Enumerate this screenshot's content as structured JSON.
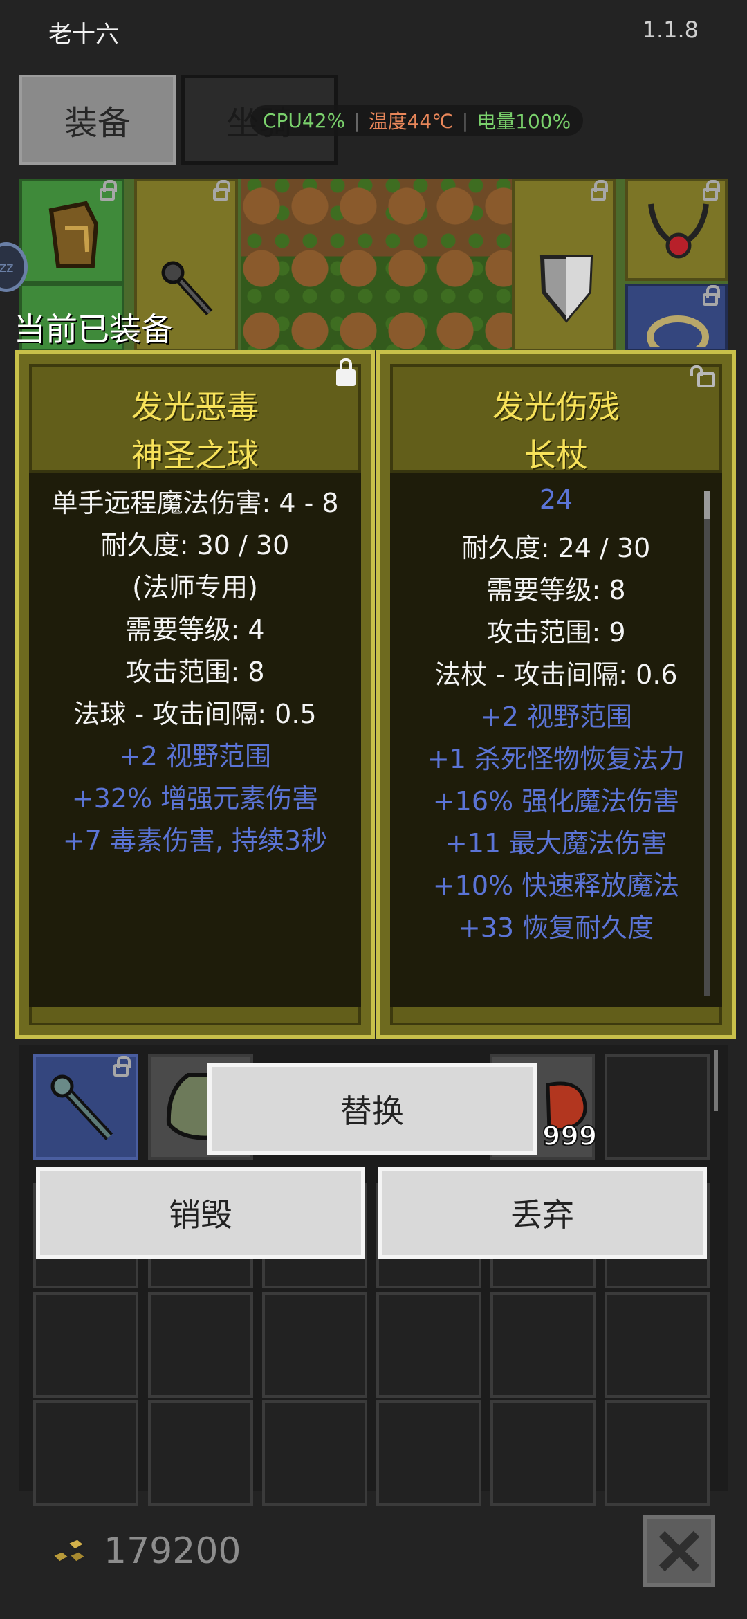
{
  "app": {
    "title": "老十六",
    "version": "1.1.8"
  },
  "tabs": [
    {
      "label": "装备",
      "active": true
    },
    {
      "label": "坐骑",
      "active": false
    }
  ],
  "status": {
    "cpu": "CPU42%",
    "temp": "温度44℃",
    "battery": "电量100%"
  },
  "section": {
    "current_equipped": "当前已装备"
  },
  "equipped": {
    "name_line1": "发光恶毒",
    "name_line2": "神圣之球",
    "locked": true,
    "lines": [
      {
        "text": "单手远程魔法伤害: 4 - 8",
        "color": "white"
      },
      {
        "text": "耐久度: 30 / 30",
        "color": "white"
      },
      {
        "text": "(法师专用)",
        "color": "white"
      },
      {
        "text": "需要等级: 4",
        "color": "white"
      },
      {
        "text": "攻击范围: 8",
        "color": "white"
      },
      {
        "text": "法球 - 攻击间隔: 0.5",
        "color": "white"
      },
      {
        "text": "+2 视野范围",
        "color": "blue"
      },
      {
        "text": "+32% 增强元素伤害",
        "color": "blue"
      },
      {
        "text": "+7 毒素伤害, 持续3秒",
        "color": "blue"
      }
    ]
  },
  "compare": {
    "name_line1": "发光伤残",
    "name_line2": "长杖",
    "locked": false,
    "lines": [
      {
        "text": "24",
        "color": "blue"
      },
      {
        "text": "耐久度: 24 / 30",
        "color": "white"
      },
      {
        "text": "需要等级: 8",
        "color": "white"
      },
      {
        "text": "攻击范围: 9",
        "color": "white"
      },
      {
        "text": "法杖 - 攻击间隔: 0.6",
        "color": "white"
      },
      {
        "text": "+2 视野范围",
        "color": "blue"
      },
      {
        "text": "+1 杀死怪物恢复法力",
        "color": "blue"
      },
      {
        "text": "+16% 强化魔法伤害",
        "color": "blue"
      },
      {
        "text": "+11 最大魔法伤害",
        "color": "blue"
      },
      {
        "text": "+10% 快速释放魔法",
        "color": "blue"
      },
      {
        "text": "+33 恢复耐久度",
        "color": "blue"
      }
    ]
  },
  "actions": {
    "replace": "替换",
    "destroy": "销毁",
    "discard": "丢弃"
  },
  "inventory": {
    "stack_count": "999"
  },
  "footer": {
    "gold": "179200"
  },
  "colors": {
    "title_yellow": "#f7e25a",
    "affix_blue": "#5b74d6",
    "card_border": "#c8c04a"
  }
}
